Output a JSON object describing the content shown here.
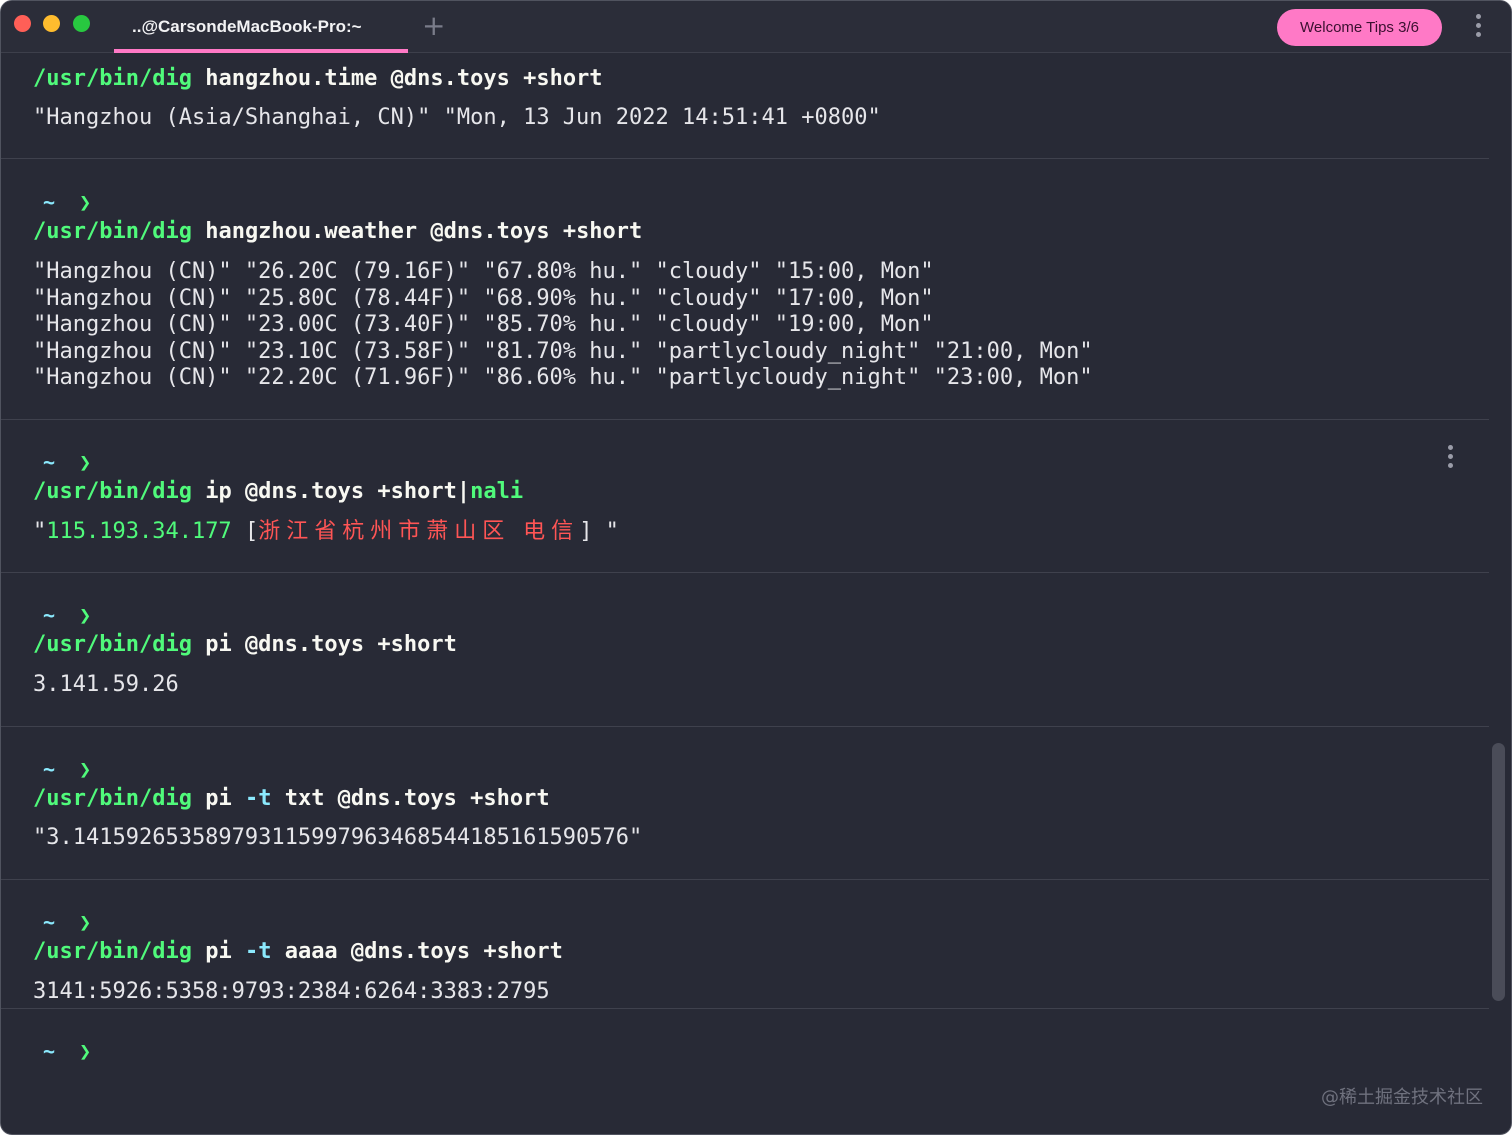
{
  "titlebar": {
    "tab_title": "..@CarsondeMacBook-Pro:~",
    "new_tab_symbol": "+",
    "welcome_label": "Welcome Tips 3/6"
  },
  "prompt": {
    "tilde": "~",
    "chevron": "❯"
  },
  "blocks": [
    {
      "path": "/usr/bin/dig",
      "args": "hangzhou.time @dns.toys +short",
      "output": [
        "\"Hangzhou (Asia/Shanghai, CN)\" \"Mon, 13 Jun 2022 14:51:41 +0800\""
      ]
    },
    {
      "path": "/usr/bin/dig",
      "args": "hangzhou.weather @dns.toys +short",
      "output": [
        "\"Hangzhou (CN)\" \"26.20C (79.16F)\" \"67.80% hu.\" \"cloudy\" \"15:00, Mon\"",
        "\"Hangzhou (CN)\" \"25.80C (78.44F)\" \"68.90% hu.\" \"cloudy\" \"17:00, Mon\"",
        "\"Hangzhou (CN)\" \"23.00C (73.40F)\" \"85.70% hu.\" \"cloudy\" \"19:00, Mon\"",
        "\"Hangzhou (CN)\" \"23.10C (73.58F)\" \"81.70% hu.\" \"partlycloudy_night\" \"21:00, Mon\"",
        "\"Hangzhou (CN)\" \"22.20C (71.96F)\" \"86.60% hu.\" \"partlycloudy_night\" \"23:00, Mon\""
      ]
    },
    {
      "path": "/usr/bin/dig",
      "args": "ip @dns.toys +short|",
      "pipe": "nali",
      "output_parts": {
        "q_open": "\"",
        "ip": "115.193.34.177",
        "space": " ",
        "br_open": "[",
        "location": "浙江省杭州市萧山区 电信",
        "br_close": "]",
        "q_close": " \""
      }
    },
    {
      "path": "/usr/bin/dig",
      "args": "pi @dns.toys +short",
      "output": [
        "3.141.59.26"
      ]
    },
    {
      "path": "/usr/bin/dig",
      "args_a": "pi ",
      "flag": "-t",
      "args_b": " txt @dns.toys +short",
      "output": [
        "\"3.141592653589793115997963468544185161590576\""
      ]
    },
    {
      "path": "/usr/bin/dig",
      "args_a": "pi ",
      "flag": "-t",
      "args_b": " aaaa @dns.toys +short",
      "output": [
        "3141:5926:5358:9793:2384:6264:3383:2795"
      ]
    }
  ],
  "watermark": "@稀土掘金技术社区",
  "colors": {
    "background": "#282a36",
    "accent": "#ff79c6",
    "path": "#50fa7b",
    "prompt_tilde": "#8be9fd",
    "ip_location": "#ff5555"
  }
}
